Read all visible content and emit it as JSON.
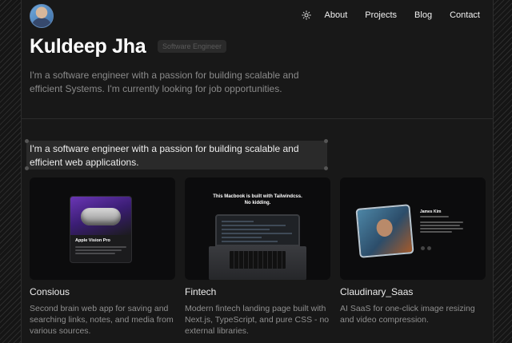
{
  "nav": {
    "links": [
      "About",
      "Projects",
      "Blog",
      "Contact"
    ],
    "theme_icon": "sun-icon"
  },
  "hero": {
    "name": "Kuldeep Jha",
    "badge": "Software Engineer",
    "description": "I'm a software engineer with a passion for building scalable and efficient Systems. I'm currently looking for job opportunities."
  },
  "highlight": {
    "text": "I'm a software engineer with a passion for building scalable and efficient web applications."
  },
  "projects": [
    {
      "title": "Consious",
      "description": "Second brain web app for saving and searching links, notes, and media from various sources.",
      "preview": {
        "product_title": "Apple Vision Pro"
      }
    },
    {
      "title": "Fintech",
      "description": "Modern fintech landing page built with Next.js, TypeScript, and pure CSS - no external libraries.",
      "preview": {
        "headline_1": "This Macbook is built with Tailwindcss.",
        "headline_2": "No kidding."
      }
    },
    {
      "title": "Claudinary_Saas",
      "description": "AI SaaS for one-click image resizing and video compression.",
      "preview": {
        "person_name": "James Kim"
      }
    }
  ],
  "colors": {
    "background": "#181818",
    "text_primary": "#ededed",
    "text_muted": "#8a8a8a"
  }
}
